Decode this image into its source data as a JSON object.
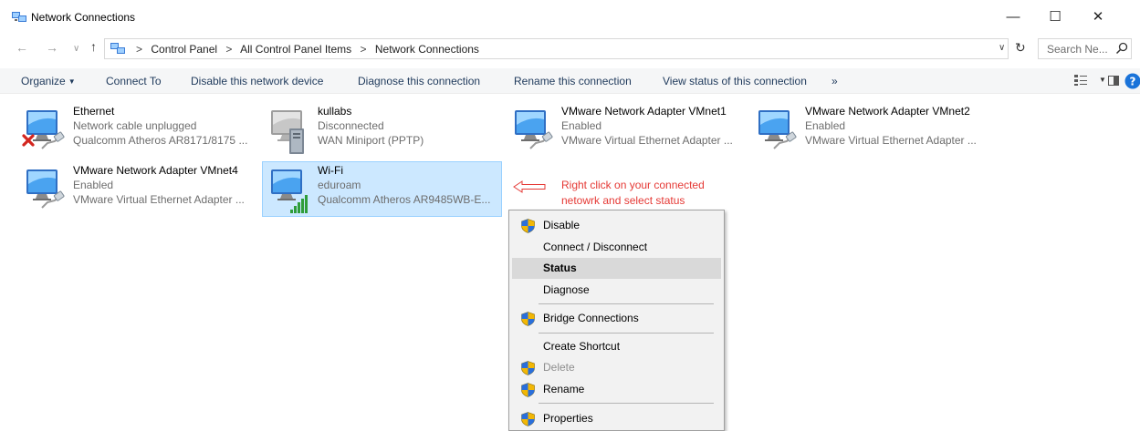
{
  "window": {
    "title": "Network Connections",
    "minimize_glyph": "—",
    "maximize_glyph": "☐",
    "close_glyph": "✕"
  },
  "nav": {
    "back_glyph": "←",
    "forward_glyph": "→",
    "recent_glyph": "∨",
    "up_glyph": "↑",
    "breadcrumbs": [
      "Control Panel",
      "All Control Panel Items",
      "Network Connections"
    ],
    "separator": ">",
    "dropdown_glyph": "∨",
    "refresh_glyph": "↻",
    "search_placeholder": "Search Ne..."
  },
  "commands": {
    "organize": "Organize",
    "organize_arrow": "▼",
    "connect_to": "Connect To",
    "disable_device": "Disable this network device",
    "diagnose": "Diagnose this connection",
    "rename": "Rename this connection",
    "view_status": "View status of this connection",
    "more": "»",
    "view_dd_glyph": "▼"
  },
  "connections": [
    {
      "name": "Ethernet",
      "status": "Network cable unplugged",
      "device": "Qualcomm Atheros AR8171/8175 ...",
      "icon": "ethernet-disconnected-icon"
    },
    {
      "name": "kullabs",
      "status": "Disconnected",
      "device": "WAN Miniport (PPTP)",
      "icon": "vpn-connection-icon"
    },
    {
      "name": "VMware Network Adapter VMnet1",
      "status": "Enabled",
      "device": "VMware Virtual Ethernet Adapter ...",
      "icon": "ethernet-adapter-icon"
    },
    {
      "name": "VMware Network Adapter VMnet2",
      "status": "Enabled",
      "device": "VMware Virtual Ethernet Adapter ...",
      "icon": "ethernet-adapter-icon"
    },
    {
      "name": "VMware Network Adapter VMnet4",
      "status": "Enabled",
      "device": "VMware Virtual Ethernet Adapter ...",
      "icon": "ethernet-adapter-icon"
    },
    {
      "name": "Wi-Fi",
      "status": "eduroam",
      "device": "Qualcomm Atheros AR9485WB-E...",
      "icon": "wifi-adapter-icon"
    }
  ],
  "annotation": {
    "line1": "Right click on your connected",
    "line2": "netowrk and select status",
    "color": "#e53935"
  },
  "context_menu": {
    "disable": "Disable",
    "connect_disconnect": "Connect / Disconnect",
    "status": "Status",
    "diagnose": "Diagnose",
    "bridge": "Bridge Connections",
    "create_shortcut": "Create Shortcut",
    "delete": "Delete",
    "rename": "Rename",
    "properties": "Properties"
  },
  "colors": {
    "selection_bg": "#cce8ff",
    "link_blue": "#1e395b",
    "menu_bg": "#f2f2f2"
  }
}
